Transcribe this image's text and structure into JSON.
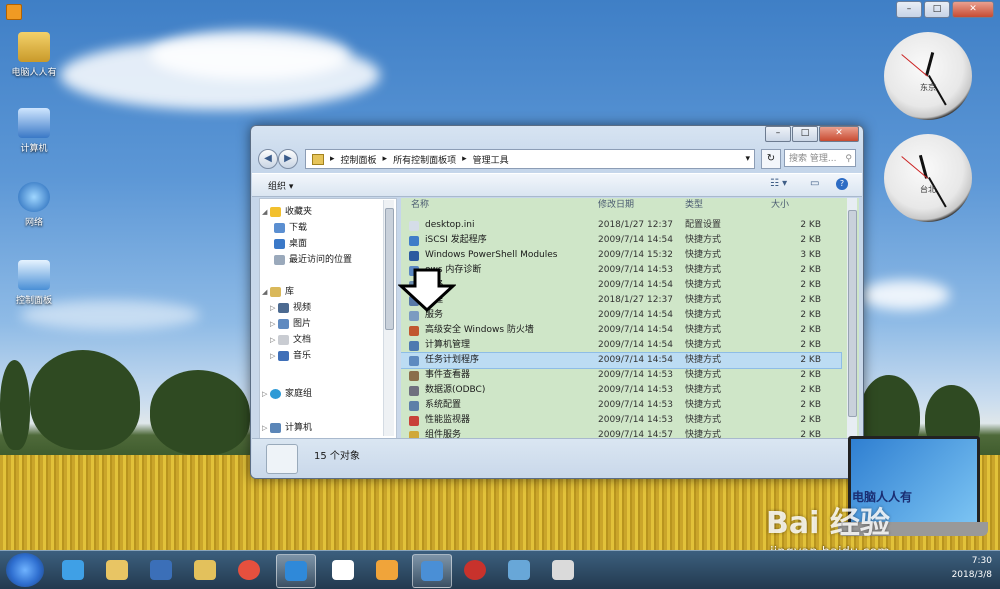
{
  "desktop": {
    "icons": [
      {
        "label": "电脑人人有",
        "icon": "user-folder-icon"
      },
      {
        "label": "计算机",
        "icon": "computer-icon"
      },
      {
        "label": "网络",
        "icon": "network-icon"
      },
      {
        "label": "控制面板",
        "icon": "control-panel-icon"
      }
    ],
    "clocks": [
      {
        "label": "东京",
        "hour_angle": 15,
        "minute_angle": 150
      },
      {
        "label": "台北",
        "hour_angle": -15,
        "minute_angle": 150
      }
    ]
  },
  "explorer": {
    "breadcrumb": [
      "控制面板",
      "所有控制面板项",
      "管理工具"
    ],
    "search_placeholder": "搜索 管理...",
    "organize_label": "组织 ▾",
    "nav": {
      "favorites": "收藏夹",
      "downloads": "下载",
      "desktop": "桌面",
      "recent": "最近访问的位置",
      "libraries": "库",
      "videos": "视频",
      "pictures": "图片",
      "documents": "文档",
      "music": "音乐",
      "homegroup": "家庭组",
      "computer": "计算机"
    },
    "columns": {
      "name": "名称",
      "date": "修改日期",
      "type": "类型",
      "size": "大小"
    },
    "files": [
      {
        "name": "desktop.ini",
        "date": "2018/1/27 12:37",
        "type": "配置设置",
        "size": "2 KB"
      },
      {
        "name": "iSCSI 发起程序",
        "date": "2009/7/14 14:54",
        "type": "快捷方式",
        "size": "2 KB"
      },
      {
        "name": "Windows PowerShell Modules",
        "date": "2009/7/14 15:32",
        "type": "快捷方式",
        "size": "3 KB"
      },
      {
        "name": "ows 内存诊断",
        "date": "2009/7/14 14:53",
        "type": "快捷方式",
        "size": "2 KB"
      },
      {
        "name": "策略",
        "date": "2009/7/14 14:54",
        "type": "快捷方式",
        "size": "2 KB"
      },
      {
        "name": "管理",
        "date": "2018/1/27 12:37",
        "type": "快捷方式",
        "size": "2 KB"
      },
      {
        "name": "服务",
        "date": "2009/7/14 14:54",
        "type": "快捷方式",
        "size": "2 KB"
      },
      {
        "name": "高级安全 Windows 防火墙",
        "date": "2009/7/14 14:54",
        "type": "快捷方式",
        "size": "2 KB"
      },
      {
        "name": "计算机管理",
        "date": "2009/7/14 14:54",
        "type": "快捷方式",
        "size": "2 KB"
      },
      {
        "name": "任务计划程序",
        "date": "2009/7/14 14:54",
        "type": "快捷方式",
        "size": "2 KB"
      },
      {
        "name": "事件查看器",
        "date": "2009/7/14 14:53",
        "type": "快捷方式",
        "size": "2 KB"
      },
      {
        "name": "数据源(ODBC)",
        "date": "2009/7/14 14:53",
        "type": "快捷方式",
        "size": "2 KB"
      },
      {
        "name": "系统配置",
        "date": "2009/7/14 14:53",
        "type": "快捷方式",
        "size": "2 KB"
      },
      {
        "name": "性能监视器",
        "date": "2009/7/14 14:53",
        "type": "快捷方式",
        "size": "2 KB"
      },
      {
        "name": "组件服务",
        "date": "2009/7/14 14:57",
        "type": "快捷方式",
        "size": "2 KB"
      }
    ],
    "highlighted_index": 9,
    "item_count": "15 个对象"
  },
  "overlay": {
    "laptop_brand": "电脑人人有",
    "watermark": "Bai 经验",
    "watermark_url": "jingyan.baidu.com"
  },
  "taskbar": {
    "time": "7:30",
    "date": "2018/3/8",
    "apps": [
      "ie-icon",
      "folder-icon",
      "media-player-icon",
      "folder-icon",
      "chrome-icon",
      "app-icon",
      "document-icon",
      "paint-icon",
      "remote-desktop-icon",
      "game-icon",
      "recycle-icon",
      "app-window-icon"
    ]
  }
}
